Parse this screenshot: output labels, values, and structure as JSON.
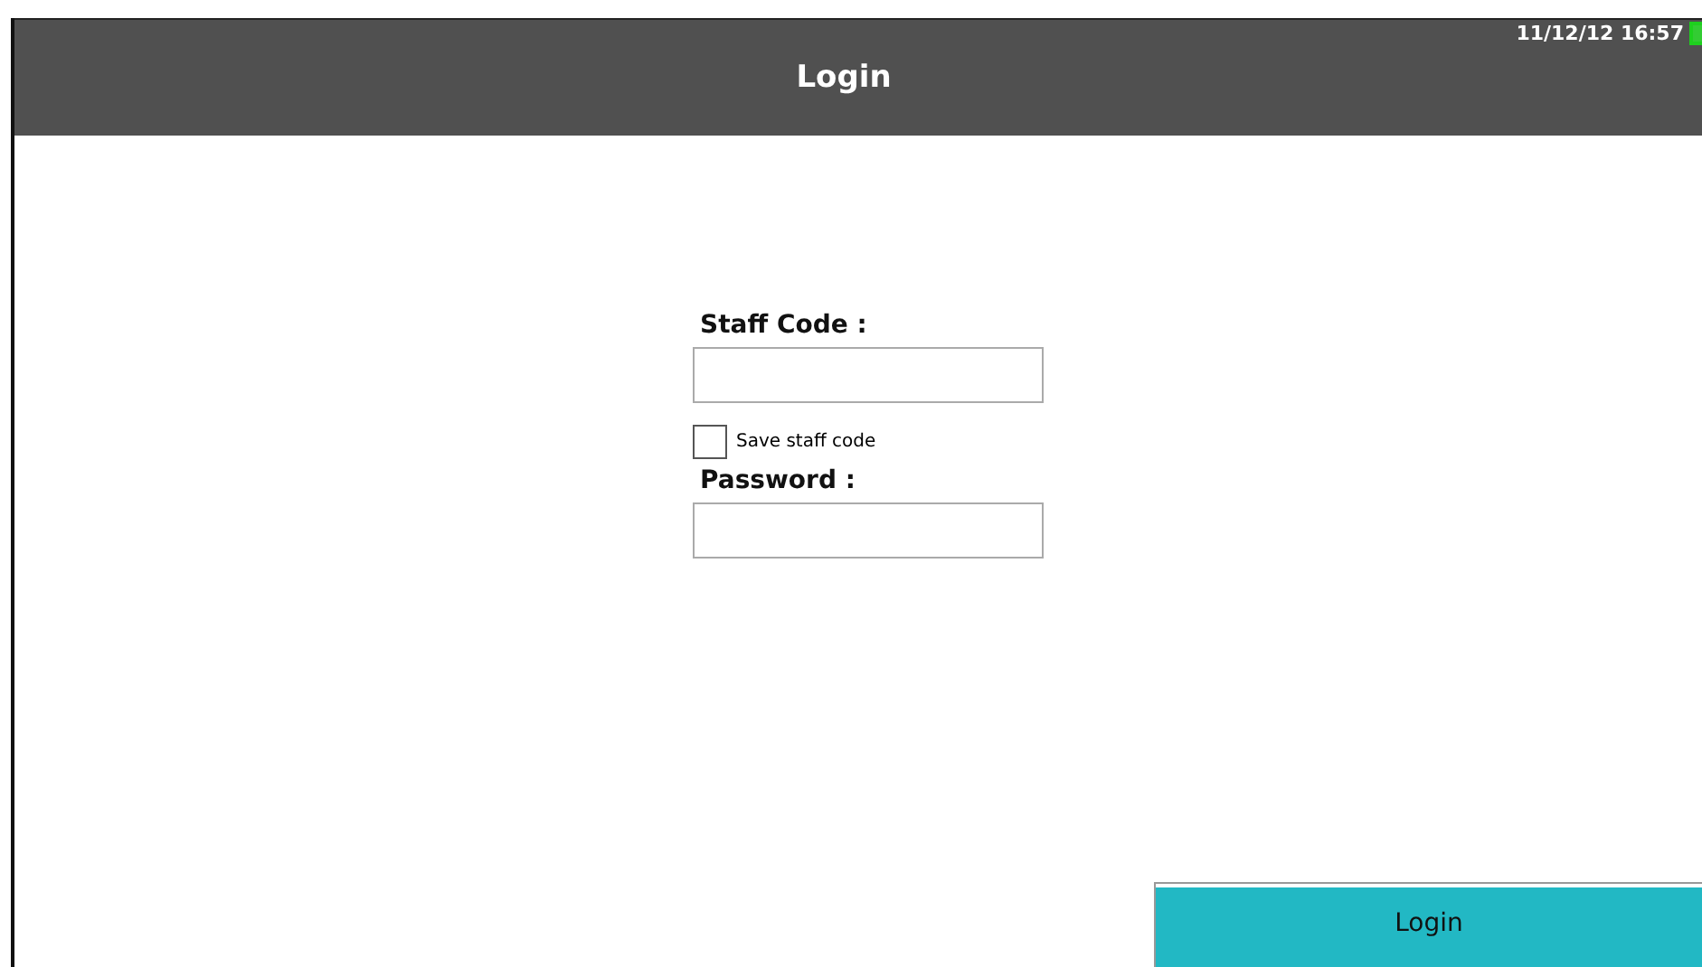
{
  "header": {
    "title": "Login",
    "datetime": "11/12/12 16:57"
  },
  "form": {
    "staff_code_label": "Staff Code :",
    "save_staff_code": {
      "label": "Save staff code",
      "checked": false
    },
    "password_label": "Password :"
  },
  "login_button": "Login"
}
